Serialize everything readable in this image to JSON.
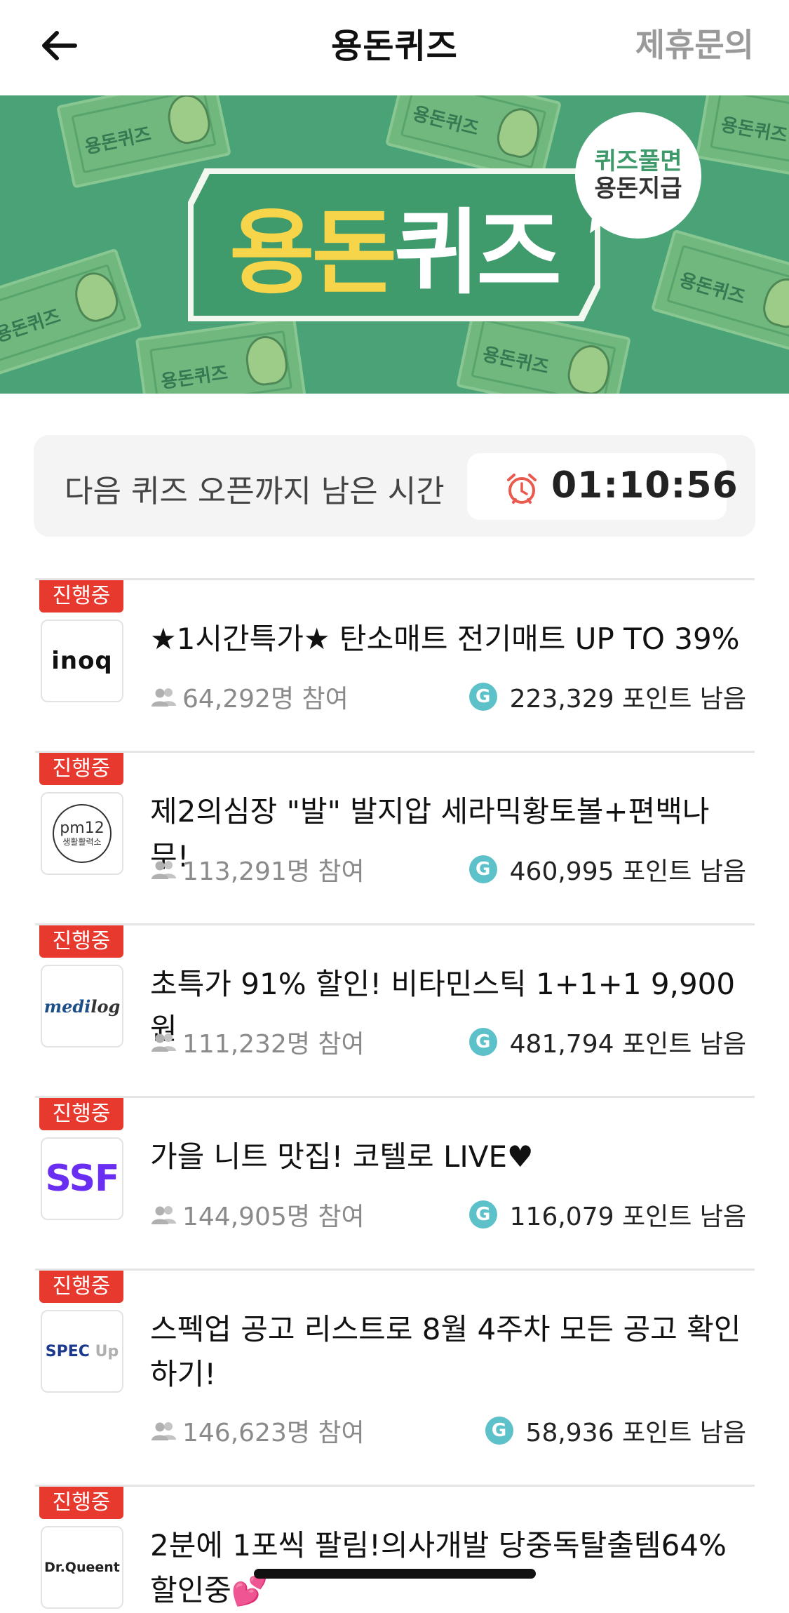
{
  "header": {
    "title": "용돈퀴즈",
    "link_label": "제휴문의"
  },
  "banner": {
    "logo_part1": "용돈",
    "logo_part2": "퀴즈",
    "bubble_line1": "퀴즈풀면",
    "bubble_line2": "용돈지급",
    "bill_text": "용돈퀴즈",
    "colors": {
      "background": "#4aa377",
      "yellow": "#f7d54a"
    }
  },
  "timer": {
    "label": "다음 퀴즈 오픈까지 남은 시간",
    "value": "01:10:56"
  },
  "quizzes": [
    {
      "badge": "진행중",
      "logo": "inoq",
      "title": "★1시간특가★ 탄소매트 전기매트 UP TO 39%",
      "participants": "64,292명 참여",
      "points": "223,329 포인트 남음"
    },
    {
      "badge": "진행중",
      "logo_main": "pm12",
      "logo_sub": "생활활력소",
      "title": "제2의심장 \"발\" 발지압 세라믹황토볼+편백나무!",
      "participants": "113,291명 참여",
      "points": "460,995 포인트 남음"
    },
    {
      "badge": "진행중",
      "logo_main": "medi",
      "logo_sub": "log",
      "title": "초특가 91% 할인! 비타민스틱 1+1+1 9,900원",
      "participants": "111,232명 참여",
      "points": "481,794 포인트 남음"
    },
    {
      "badge": "진행중",
      "logo": "SSF",
      "title": "가을 니트 맛집! 코텔로 LIVE♥",
      "participants": "144,905명 참여",
      "points": "116,079 포인트 남음"
    },
    {
      "badge": "진행중",
      "logo_main": "SPEC",
      "logo_sub": "Up",
      "title": "스펙업 공고 리스트로 8월 4주차 모든 공고 확인하기!",
      "participants": "146,623명 참여",
      "points": "58,936 포인트 남음"
    },
    {
      "badge": "진행중",
      "logo": "Dr.Queent",
      "title": "2분에 1포씩 팔림!의사개발 당중독탈출템64%할인중💕"
    }
  ],
  "point_icon_letter": "G",
  "icons": {
    "back": "arrow-left-icon",
    "clock": "alarm-clock-icon",
    "people": "people-icon",
    "point": "g-point-icon"
  }
}
